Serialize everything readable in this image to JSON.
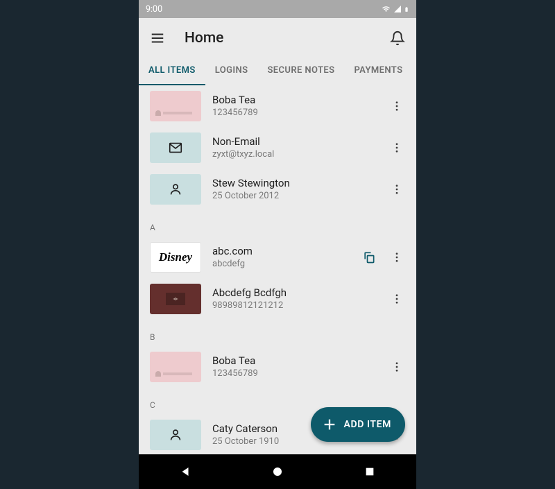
{
  "status": {
    "time": "9:00"
  },
  "header": {
    "title": "Home"
  },
  "tabs": [
    {
      "label": "ALL ITEMS",
      "active": true
    },
    {
      "label": "LOGINS",
      "active": false
    },
    {
      "label": "SECURE NOTES",
      "active": false
    },
    {
      "label": "PAYMENTS",
      "active": false
    }
  ],
  "sections": [
    {
      "header": null,
      "items": [
        {
          "icon": "identity-card-pink",
          "title": "Boba Tea",
          "subtitle": "123456789",
          "copy": false
        },
        {
          "icon": "mail-teal",
          "title": "Non-Email",
          "subtitle": "zyxt@txyz.local",
          "copy": false
        },
        {
          "icon": "person-teal",
          "title": "Stew Stewington",
          "subtitle": "25 October 2012",
          "copy": false
        }
      ]
    },
    {
      "header": "A",
      "items": [
        {
          "icon": "disney-logo",
          "title": "abc.com",
          "subtitle": "abcdefg",
          "copy": true
        },
        {
          "icon": "wallet-brown",
          "title": "Abcdefg Bcdfgh",
          "subtitle": "98989812121212",
          "copy": false
        }
      ]
    },
    {
      "header": "B",
      "items": [
        {
          "icon": "identity-card-pink",
          "title": "Boba Tea",
          "subtitle": "123456789",
          "copy": false
        }
      ]
    },
    {
      "header": "C",
      "items": [
        {
          "icon": "person-teal",
          "title": "Caty Caterson",
          "subtitle": "25 October 1910",
          "copy": false
        }
      ]
    }
  ],
  "fab": {
    "label": "ADD ITEM"
  }
}
